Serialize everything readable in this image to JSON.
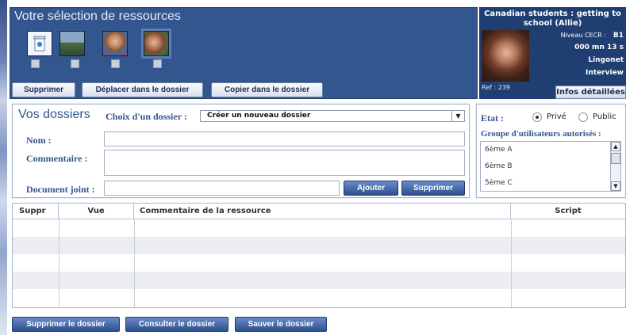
{
  "selection": {
    "title": "Votre sélection de ressources",
    "thumbnails": [
      {
        "icon": "trash-document-icon"
      },
      {
        "icon": "landscape-photo-icon"
      },
      {
        "icon": "person-photo-icon"
      },
      {
        "icon": "people-photo-icon"
      }
    ],
    "buttons": {
      "delete": "Supprimer",
      "move": "Déplacer dans le dossier",
      "copy": "Copier dans le dossier"
    }
  },
  "resource": {
    "title": "Canadian students : getting to school (Allie)",
    "level_label": "Niveau CECR :",
    "level_value": "B1",
    "duration": "000 mn 13 s",
    "source": "Lingonet",
    "type": "Interview",
    "ref": "Ref : 239",
    "details_button": "Infos détaillées"
  },
  "folders": {
    "title": "Vos dossiers",
    "choose_label": "Choix d'un dossier :",
    "dropdown_value": "Créer un nouveau dossier",
    "name_label": "Nom :",
    "name_value": "",
    "comment_label": "Commentaire :",
    "comment_value": "",
    "attachment_label": "Document joint :",
    "attachment_value": "",
    "add_button": "Ajouter",
    "remove_button": "Supprimer"
  },
  "state": {
    "label": "Etat :",
    "private": "Privé",
    "public": "Public",
    "selected": "Privé",
    "groups_label": "Groupe d'utilisateurs autorisés :",
    "groups": [
      "6ème A",
      "6ème B",
      "5ème C"
    ]
  },
  "table": {
    "headers": [
      "Suppr",
      "Vue",
      "Commentaire de la ressource",
      "Script"
    ],
    "rows": 5
  },
  "actions": {
    "delete_folder": "Supprimer le dossier",
    "view_folder": "Consulter le dossier",
    "save_folder": "Sauver le dossier"
  },
  "colors": {
    "panel_blue": "#34568f",
    "accent_text": "#33558e"
  }
}
